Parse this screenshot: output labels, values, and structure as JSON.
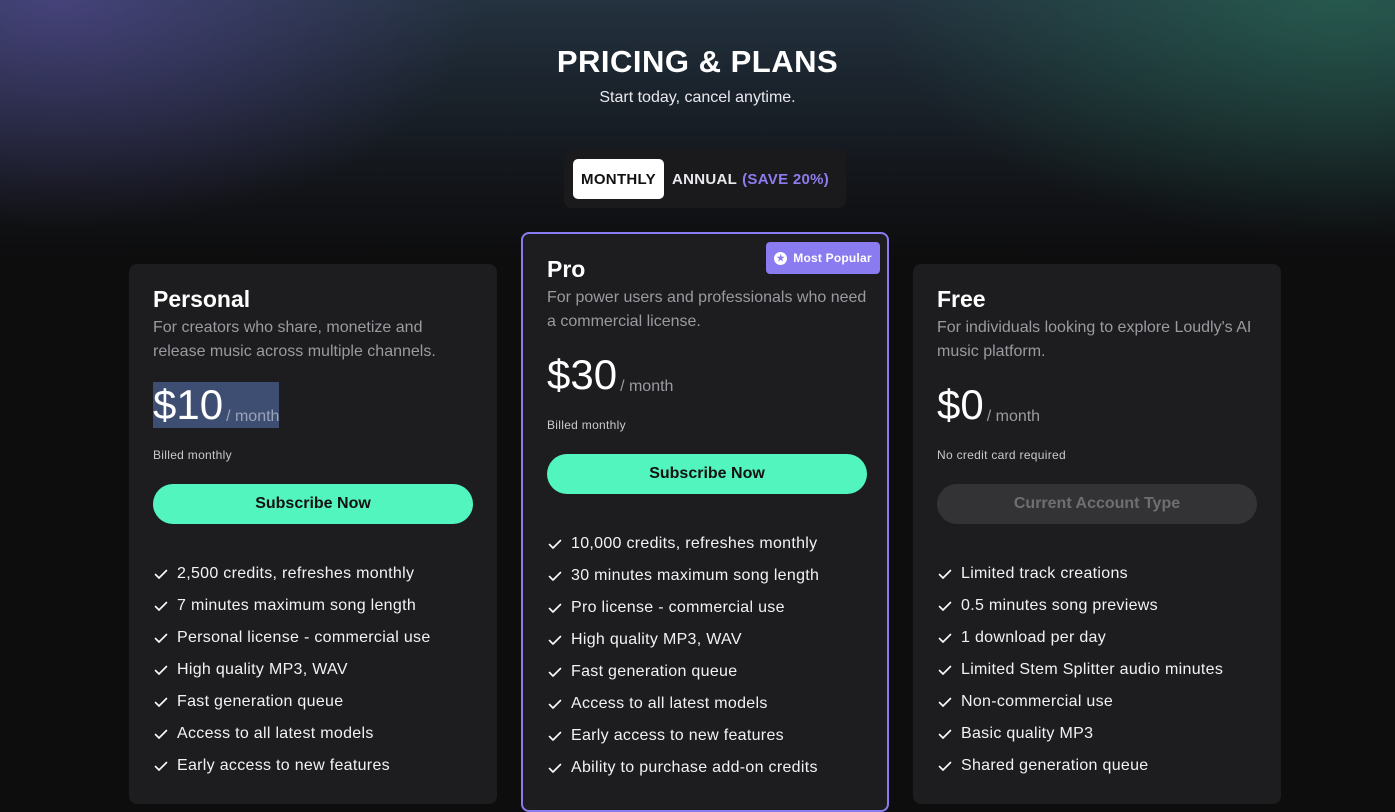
{
  "header": {
    "title": "PRICING & PLANS",
    "subtitle": "Start today, cancel anytime."
  },
  "billing_toggle": {
    "monthly_label": "MONTHLY",
    "annual_label": "ANNUAL",
    "annual_save": "(SAVE 20%)",
    "selected": "monthly"
  },
  "colors": {
    "accent_green": "#52f5bd",
    "accent_purple": "#8a7bf0",
    "card_bg": "#1d1d1f",
    "page_bg": "#0d0d0e"
  },
  "plans": [
    {
      "name": "Personal",
      "description": "For creators who share, monetize and release music across multiple channels.",
      "price": "$10",
      "period": "/ month",
      "billing_note": "Billed monthly",
      "cta_label": "Subscribe Now",
      "features": [
        "2,500 credits, refreshes monthly",
        "7 minutes maximum song length",
        "Personal license - commercial use",
        "High quality MP3, WAV",
        "Fast generation queue",
        "Access to all latest models",
        "Early access to new features"
      ]
    },
    {
      "name": "Pro",
      "badge": "Most Popular",
      "badge_icon": "star-circle-icon",
      "description": "For power users and professionals who need a commercial license.",
      "price": "$30",
      "period": "/ month",
      "billing_note": "Billed monthly",
      "cta_label": "Subscribe Now",
      "features": [
        "10,000 credits, refreshes monthly",
        "30 minutes maximum song length",
        "Pro license - commercial use",
        "High quality MP3, WAV",
        "Fast generation queue",
        "Access to all latest models",
        "Early access to new features",
        "Ability to purchase add-on credits"
      ]
    },
    {
      "name": "Free",
      "description": "For individuals looking to explore Loudly's AI music platform.",
      "price": "$0",
      "period": "/ month",
      "billing_note": "No credit card required",
      "cta_label": "Current Account Type",
      "features": [
        "Limited track creations",
        "0.5 minutes song previews",
        "1 download per day",
        "Limited Stem Splitter audio minutes",
        "Non-commercial use",
        "Basic quality MP3",
        "Shared generation queue"
      ]
    }
  ]
}
